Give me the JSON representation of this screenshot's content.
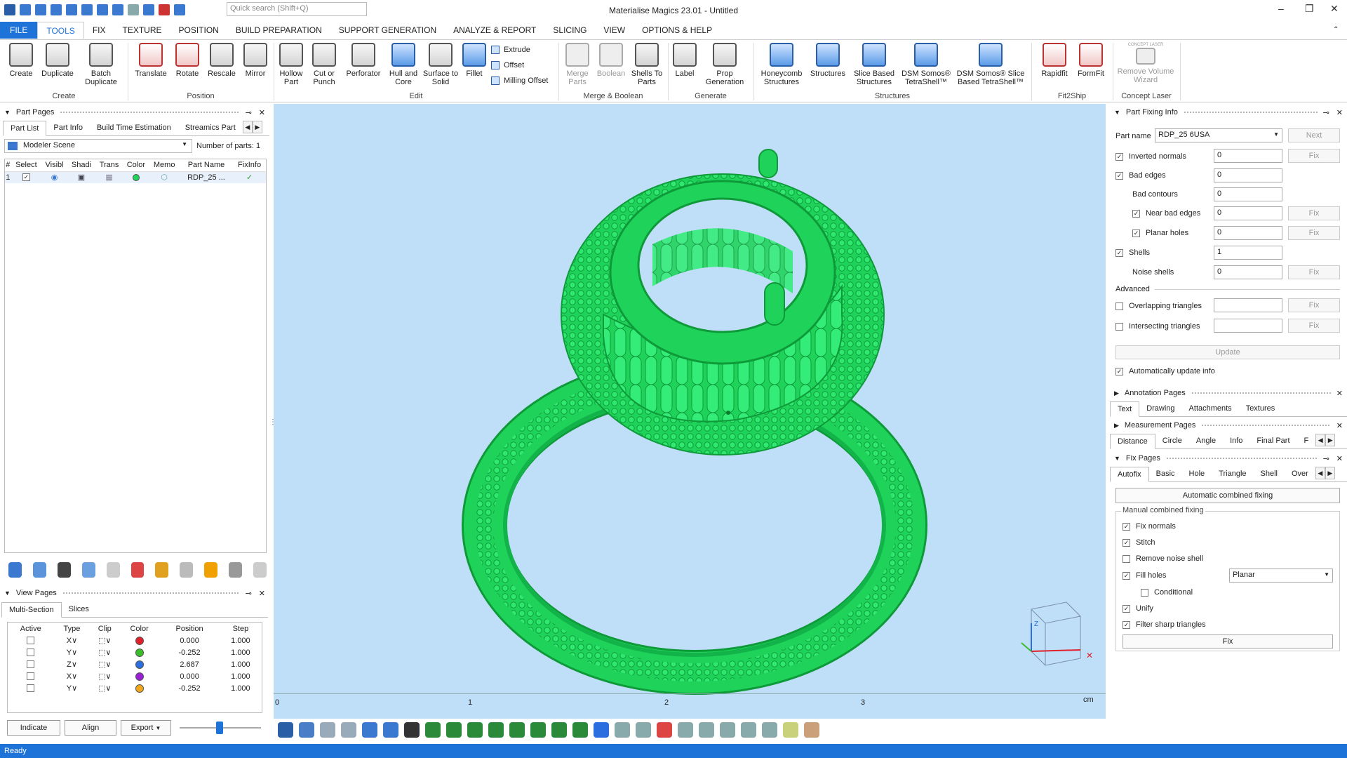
{
  "app": {
    "title": "Materialise Magics 23.01 - Untitled",
    "search_placeholder": "Quick search (Shift+Q)"
  },
  "menu": [
    "FILE",
    "TOOLS",
    "FIX",
    "TEXTURE",
    "POSITION",
    "BUILD PREPARATION",
    "SUPPORT GENERATION",
    "ANALYZE & REPORT",
    "SLICING",
    "VIEW",
    "OPTIONS & HELP"
  ],
  "ribbon": {
    "create": {
      "label": "Create",
      "buttons": [
        "Create",
        "Duplicate",
        "Batch Duplicate"
      ]
    },
    "position": {
      "label": "Position",
      "buttons": [
        "Translate",
        "Rotate",
        "Rescale",
        "Mirror"
      ]
    },
    "edit": {
      "label": "Edit",
      "buttons": [
        "Hollow Part",
        "Cut or Punch",
        "Perforator",
        "Hull and Core",
        "Surface to Solid",
        "Fillet"
      ],
      "small": [
        "Extrude",
        "Offset",
        "Milling Offset"
      ]
    },
    "merge": {
      "label": "Merge & Boolean",
      "buttons": [
        "Merge Parts",
        "Boolean",
        "Shells To Parts"
      ]
    },
    "generate": {
      "label": "Generate",
      "buttons": [
        "Label",
        "Prop Generation"
      ]
    },
    "structures": {
      "label": "Structures",
      "buttons": [
        "Honeycomb Structures",
        "Structures",
        "Slice Based Structures",
        "DSM Somos® TetraShell™",
        "DSM Somos® Slice Based TetraShell™"
      ]
    },
    "fit2ship": {
      "label": "Fit2Ship",
      "buttons": [
        "Rapidfit",
        "FormFit"
      ]
    },
    "concept": {
      "label": "Concept Laser",
      "buttons": [
        "Remove Volume Wizard"
      ],
      "badge": "CONCEPT LASER"
    }
  },
  "part_pages": {
    "title": "Part Pages",
    "tabs": [
      "Part List",
      "Part Info",
      "Build Time Estimation",
      "Streamics Part"
    ],
    "scene": "Modeler Scene",
    "num_parts_label": "Number of parts:",
    "num_parts": "1",
    "columns": [
      "#",
      "Select",
      "Visibl",
      "Shadi",
      "Trans",
      "Color",
      "Memo",
      "Part Name",
      "FixInfo"
    ],
    "row": {
      "index": "1",
      "name": "RDP_25 ...",
      "fixinfo": "✓"
    }
  },
  "view_pages": {
    "title": "View Pages",
    "tabs": [
      "Multi-Section",
      "Slices"
    ],
    "columns": [
      "Active",
      "Type",
      "Clip",
      "Color",
      "Position",
      "Step"
    ],
    "rows": [
      {
        "type": "X",
        "color": "#e0202a",
        "position": "0.000",
        "step": "1.000"
      },
      {
        "type": "Y",
        "color": "#3bbd2a",
        "position": "-0.252",
        "step": "1.000"
      },
      {
        "type": "Z",
        "color": "#2a6ee0",
        "position": "2.687",
        "step": "1.000"
      },
      {
        "type": "X",
        "color": "#9a1fd6",
        "position": "0.000",
        "step": "1.000"
      },
      {
        "type": "Y",
        "color": "#f2a81c",
        "position": "-0.252",
        "step": "1.000"
      }
    ],
    "buttons": {
      "indicate": "Indicate",
      "align": "Align",
      "export": "Export"
    }
  },
  "viewport": {
    "ruler": [
      "0",
      "1",
      "2",
      "3"
    ],
    "unit": "cm",
    "part_color": "#1fd35a",
    "bg": "#bfdff9"
  },
  "fixing_info": {
    "title": "Part Fixing Info",
    "part_name_label": "Part name",
    "part_name": "RDP_25 6USA",
    "next": "Next",
    "fix": "Fix",
    "inverted_normals": {
      "label": "Inverted normals",
      "value": "0"
    },
    "bad_edges": {
      "label": "Bad edges",
      "value": "0"
    },
    "bad_contours": {
      "label": "Bad contours",
      "value": "0"
    },
    "near_bad_edges": {
      "label": "Near bad edges",
      "value": "0"
    },
    "planar_holes": {
      "label": "Planar holes",
      "value": "0"
    },
    "shells": {
      "label": "Shells",
      "value": "1"
    },
    "noise_shells": {
      "label": "Noise shells",
      "value": "0"
    },
    "advanced": "Advanced",
    "overlapping": "Overlapping triangles",
    "intersecting": "Intersecting triangles",
    "update": "Update",
    "auto_update": "Automatically update info"
  },
  "annotation_pages": {
    "title": "Annotation Pages",
    "tabs": [
      "Text",
      "Drawing",
      "Attachments",
      "Textures"
    ]
  },
  "measurement_pages": {
    "title": "Measurement Pages",
    "tabs": [
      "Distance",
      "Circle",
      "Angle",
      "Info",
      "Final Part",
      "F"
    ]
  },
  "fix_pages": {
    "title": "Fix Pages",
    "tabs": [
      "Autofix",
      "Basic",
      "Hole",
      "Triangle",
      "Shell",
      "Over"
    ],
    "auto_combined": "Automatic combined fixing",
    "manual_label": "Manual combined fixing",
    "options": {
      "fix_normals": "Fix normals",
      "stitch": "Stitch",
      "remove_noise": "Remove noise shell",
      "fill_holes": "Fill holes",
      "conditional": "Conditional",
      "unify": "Unify",
      "filter_sharp": "Filter sharp triangles"
    },
    "fill_mode": "Planar",
    "fix_button": "Fix"
  },
  "status": "Ready"
}
